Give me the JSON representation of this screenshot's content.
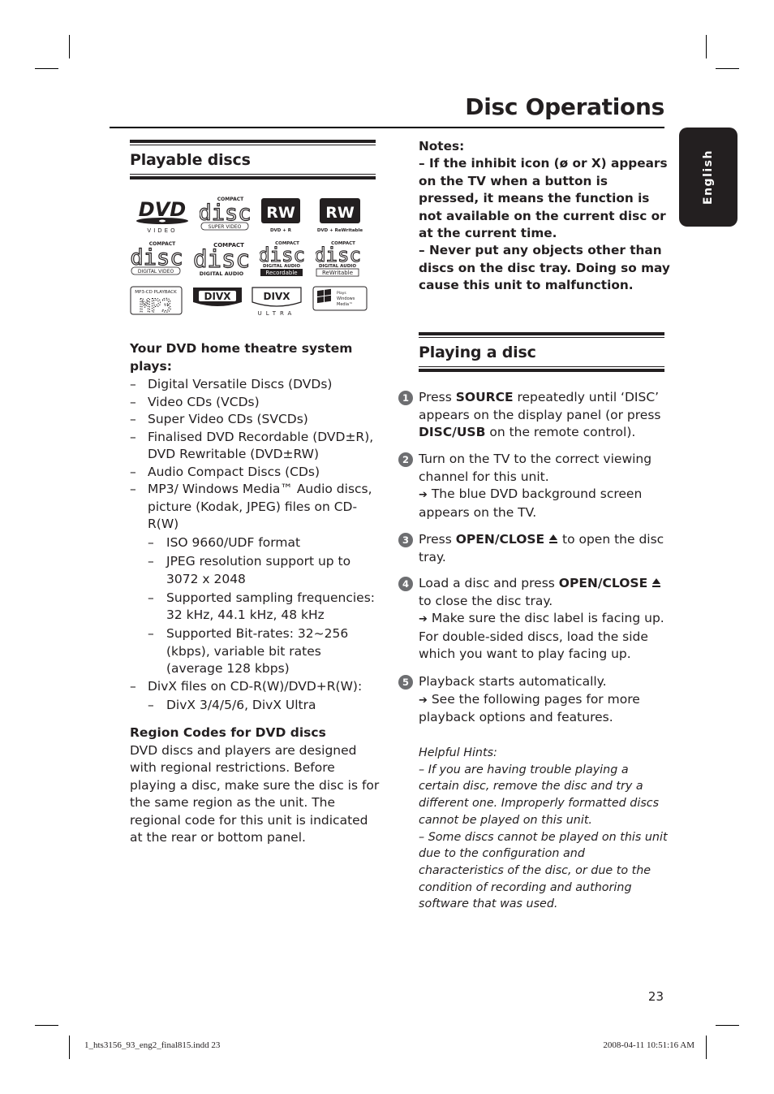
{
  "page": {
    "title": "Disc Operations",
    "language_tab": "English",
    "page_number": "23",
    "slug_left": "1_hts3156_93_eng2_final815.indd   23",
    "slug_right": "2008-04-11   10:51:16 AM"
  },
  "playable_discs": {
    "heading": "Playable discs",
    "logos": [
      {
        "name": "dvd-video-logo",
        "main": "DVD",
        "sub": "VIDEO"
      },
      {
        "name": "compact-disc-super-video-logo",
        "top": "COMPACT",
        "main": "disc",
        "sub": "SUPER VIDEO"
      },
      {
        "name": "dvd-plus-r-logo",
        "main": "RW",
        "sub": "DVD + R"
      },
      {
        "name": "dvd-plus-rewritable-logo",
        "main": "RW",
        "sub": "DVD + ReWritable"
      },
      {
        "name": "compact-disc-digital-video-logo",
        "top": "COMPACT",
        "main": "disc",
        "sub": "DIGITAL VIDEO"
      },
      {
        "name": "compact-disc-digital-audio-logo",
        "top": "COMPACT",
        "main": "disc",
        "sub": "DIGITAL AUDIO"
      },
      {
        "name": "compact-disc-recordable-logo",
        "top": "COMPACT",
        "main": "disc",
        "sub": "DIGITAL AUDIO",
        "sub2": "Recordable"
      },
      {
        "name": "compact-disc-rewritable-logo",
        "top": "COMPACT",
        "main": "disc",
        "sub": "DIGITAL AUDIO",
        "sub2": "ReWritable"
      },
      {
        "name": "mp3-cd-playback-logo",
        "top": "MP3-CD PLAYBACK",
        "main": "MP3"
      },
      {
        "name": "divx-logo",
        "main": "DIVX"
      },
      {
        "name": "divx-ultra-logo",
        "main": "DIVX",
        "sub": "ULTRA"
      },
      {
        "name": "plays-windows-media-logo",
        "top": "Plays",
        "main": "Windows",
        "sub": "Media™"
      }
    ],
    "plays_heading": "Your DVD home theatre system plays:",
    "items": [
      {
        "level": 1,
        "text": "Digital Versatile Discs (DVDs)"
      },
      {
        "level": 1,
        "text": "Video CDs (VCDs)"
      },
      {
        "level": 1,
        "text": "Super Video CDs (SVCDs)"
      },
      {
        "level": 1,
        "text": "Finalised DVD Recordable (DVD±R), DVD Rewritable (DVD±RW)"
      },
      {
        "level": 1,
        "text": "Audio Compact Discs (CDs)"
      },
      {
        "level": 1,
        "text": "MP3/ Windows Media™ Audio discs, picture (Kodak, JPEG) files on CD-R(W)"
      },
      {
        "level": 2,
        "text": "ISO 9660/UDF format"
      },
      {
        "level": 2,
        "text": "JPEG resolution support up to 3072 x 2048"
      },
      {
        "level": 2,
        "text": "Supported sampling frequencies: 32 kHz, 44.1 kHz, 48 kHz"
      },
      {
        "level": 2,
        "text": "Supported Bit-rates: 32~256 (kbps), variable bit rates (average 128 kbps)"
      },
      {
        "level": 1,
        "text": "DivX files on CD-R(W)/DVD+R(W):"
      },
      {
        "level": 2,
        "text": "DivX 3/4/5/6, DivX Ultra"
      }
    ],
    "dash": "–",
    "region_heading": "Region Codes for DVD discs",
    "region_text": "DVD discs and players are designed with regional restrictions. Before playing a disc, make sure the disc is for the same region as the unit. The regional code for this unit is indicated at the rear or bottom panel."
  },
  "notes": {
    "heading": "Notes:",
    "lines": [
      "– If the inhibit icon (ø or X) appears on the TV when a button is pressed, it means the function is not available on the current disc or at the current time.",
      "– Never put any objects other than discs on the disc tray. Doing so may cause this unit to malfunction."
    ]
  },
  "playing_a_disc": {
    "heading": "Playing a disc",
    "arrow": "➔",
    "eject_symbol": "≜",
    "steps": [
      {
        "num": "1",
        "pre": "Press ",
        "key": "SOURCE",
        "mid": " repeatedly until ‘DISC’ appears on the display panel (or press ",
        "key2": "DISC/USB",
        "post": " on the remote control)."
      },
      {
        "num": "2",
        "text": "Turn on the TV to the correct viewing channel for this unit.",
        "result": "The blue DVD background screen appears on the TV."
      },
      {
        "num": "3",
        "pre": "Press ",
        "key": "OPEN/CLOSE",
        "post": " to open the disc tray."
      },
      {
        "num": "4",
        "pre": "Load a disc and press ",
        "key": "OPEN/CLOSE",
        "post": " to close the disc tray.",
        "result": "Make sure the disc label is facing up. For double-sided discs, load the side which you want to play facing up."
      },
      {
        "num": "5",
        "text": "Playback starts automatically.",
        "result": "See the following pages for more playback options and features."
      }
    ]
  },
  "hints": {
    "heading": "Helpful Hints:",
    "lines": [
      "– If you are having trouble playing a certain disc, remove the disc and try a different one. Improperly formatted discs cannot be played on this unit.",
      "– Some discs cannot be played on this unit due to the configuration and characteristics of the disc, or due to the condition of recording and authoring software that was used."
    ]
  }
}
